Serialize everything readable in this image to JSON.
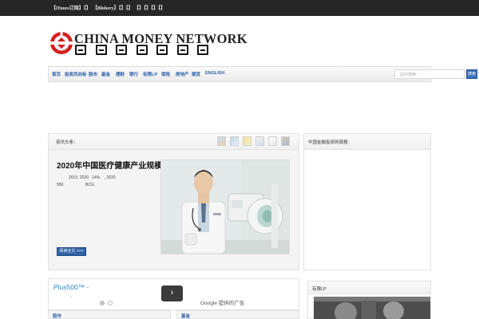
{
  "topbar": {
    "links": [
      {
        "label": "【iTunes订阅】【】"
      },
      {
        "label": "【Bluhery】【】【】"
      },
      {
        "label": "【】【】【】【】"
      }
    ]
  },
  "logo": {
    "english": "CHINA MONEY NETWORK",
    "chinese": "中国金融投资网"
  },
  "nav": {
    "items": [
      {
        "label": "首页"
      },
      {
        "label": "投资风向标"
      },
      {
        "label": "股市"
      },
      {
        "label": "基金"
      },
      {
        "label": "理财"
      },
      {
        "label": "银行"
      },
      {
        "label": "有限LP"
      },
      {
        "label": "保险"
      },
      {
        "label": "房地产"
      },
      {
        "label": "期货"
      },
      {
        "label": "ENGLISH"
      }
    ],
    "search_placeholder": "站内搜索：",
    "search_button": "搜索"
  },
  "feature": {
    "header": "资讯头条：",
    "headline": "2020年中国医疗健康产业规模预测：",
    "summary_line1": "2013  2020   14%    , 2020",
    "summary_line2": "550                    BCG",
    "more_button": "阅读全文 >>>"
  },
  "sidebar1": {
    "header": "中国金融投资网周报："
  },
  "ad": {
    "title": "Plus500™ -",
    "subtitle": "-",
    "arrow": "›",
    "google_label": "Google 提供的广告"
  },
  "bottom": {
    "left_header": "股市",
    "mid_header": "基金"
  },
  "sidebar2": {
    "header": "有限LP"
  },
  "colors": {
    "topbar_bg": "#262626",
    "logo_red": "#d6201f",
    "nav_link": "#2a5ea8",
    "button_blue": "#2f62a5",
    "ad_link": "#2a86c8"
  }
}
